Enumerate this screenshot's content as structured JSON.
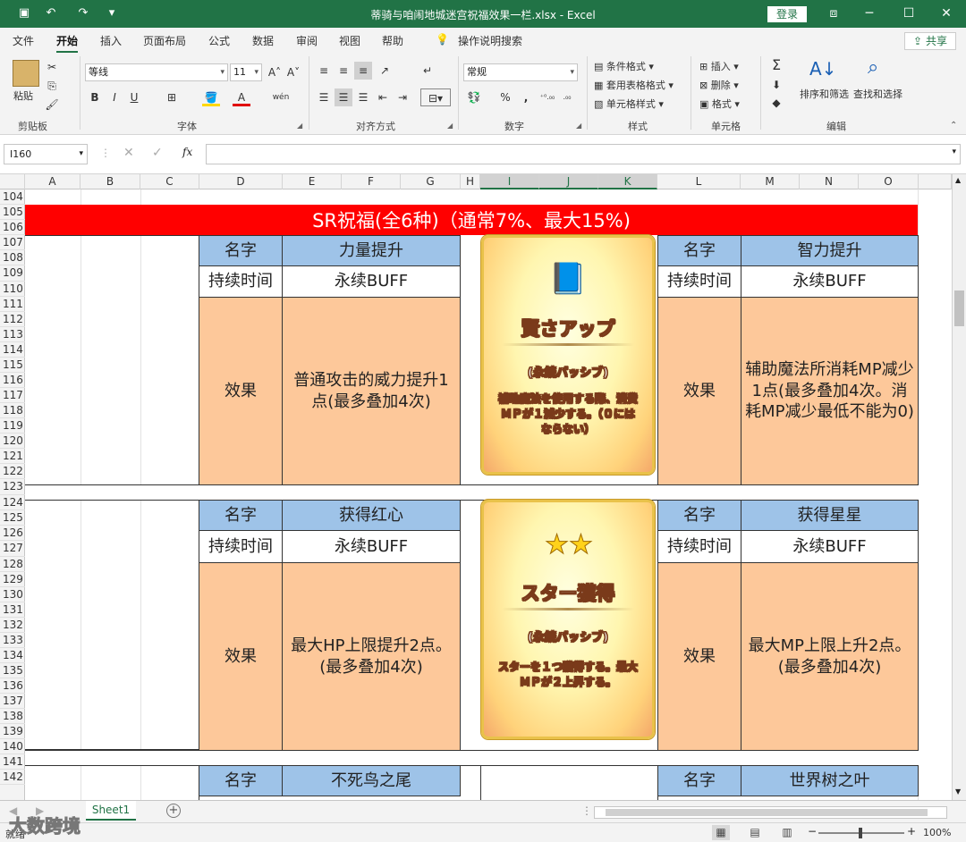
{
  "window": {
    "title": "蒂骑与咱闹地城迷宫祝福效果一栏.xlsx  -  Excel",
    "login": "登录",
    "qat_save": "▣",
    "qat_undo": "↶",
    "qat_redo": "↷",
    "qat_more": "▾",
    "restore_icon": "⧈",
    "minimize": "─",
    "maximize": "☐",
    "close": "✕"
  },
  "menu": {
    "tabs": [
      "文件",
      "开始",
      "插入",
      "页面布局",
      "公式",
      "数据",
      "审阅",
      "视图",
      "帮助"
    ],
    "active": "开始",
    "tell_me": "操作说明搜索",
    "share": "共享"
  },
  "ribbon": {
    "clipboard": {
      "paste": "粘贴",
      "label": "剪贴板"
    },
    "font": {
      "name": "等线",
      "size": "11",
      "label": "字体",
      "bold": "B",
      "italic": "I",
      "underline": "U",
      "grow": "A˄",
      "shrink": "A˅",
      "color_a": "A",
      "wen": "wén"
    },
    "alignment": {
      "label": "对齐方式"
    },
    "number": {
      "format": "常规",
      "label": "数字",
      "percent": "%",
      "comma": ",",
      "inc": "⁺⁰.₀₀",
      "dec": ".₀₀"
    },
    "styles": {
      "cond": "条件格式",
      "table": "套用表格格式",
      "cell": "单元格样式",
      "label": "样式"
    },
    "cells": {
      "insert": "插入",
      "delete": "删除",
      "format": "格式",
      "label": "单元格"
    },
    "editing": {
      "sort": "排序和筛选",
      "find": "查找和选择",
      "label": "编辑",
      "sigma": "Σ"
    }
  },
  "formula_bar": {
    "name_box": "I160",
    "fx": "fx",
    "value": ""
  },
  "columns": [
    "A",
    "B",
    "C",
    "D",
    "E",
    "F",
    "G",
    "H",
    "I",
    "J",
    "K",
    "L",
    "M",
    "N",
    "O"
  ],
  "selected_columns": [
    "I",
    "J",
    "K"
  ],
  "rows": [
    "104",
    "105",
    "106",
    "107",
    "108",
    "109",
    "110",
    "111",
    "112",
    "113",
    "114",
    "115",
    "116",
    "117",
    "118",
    "119",
    "120",
    "121",
    "122",
    "123",
    "124",
    "125",
    "126",
    "127",
    "128",
    "129",
    "130",
    "131",
    "132",
    "133",
    "134",
    "135",
    "136",
    "137",
    "138",
    "139",
    "140",
    "141",
    "142"
  ],
  "banner": "SR祝福(全6种)（通常7%、最大15%)",
  "blocks": [
    {
      "left": {
        "name_label": "名字",
        "name": "力量提升",
        "duration_label": "持续时间",
        "duration": "永续BUFF",
        "effect_label": "效果",
        "effect": "普通攻击的威力提升1点(最多叠加4次)"
      },
      "card": {
        "icon": "📘",
        "title": "賢さアップ",
        "sub": "(永続パッシブ)",
        "desc": "補助魔法を使用する際、消費ＭＰが１減少する。（０にはならない）"
      },
      "right": {
        "name_label": "名字",
        "name": "智力提升",
        "duration_label": "持续时间",
        "duration": "永续BUFF",
        "effect_label": "效果",
        "effect": "辅助魔法所消耗MP减少1点(最多叠加4次。消耗MP减少最低不能为0)"
      }
    },
    {
      "left": {
        "name_label": "名字",
        "name": "获得红心",
        "duration_label": "持续时间",
        "duration": "永续BUFF",
        "effect_label": "效果",
        "effect": "最大HP上限提升2点。(最多叠加4次)"
      },
      "card": {
        "icon": "★★",
        "title": "スター獲得",
        "sub": "(永続パッシブ)",
        "desc": "スターを１つ獲得する。最大ＭＰが２上昇する。"
      },
      "right": {
        "name_label": "名字",
        "name": "获得星星",
        "duration_label": "持续时间",
        "duration": "永续BUFF",
        "effect_label": "效果",
        "effect": "最大MP上限上升2点。(最多叠加4次)"
      }
    },
    {
      "left": {
        "name_label": "名字",
        "name": "不死鸟之尾"
      },
      "right": {
        "name_label": "名字",
        "name": "世界树之叶"
      }
    }
  ],
  "sheet_tabs": [
    "Sheet1"
  ],
  "status": {
    "ready": "就绪",
    "zoom": "100%",
    "watermark": "大数跨境",
    "zoom_minus": "−",
    "zoom_plus": "+"
  }
}
